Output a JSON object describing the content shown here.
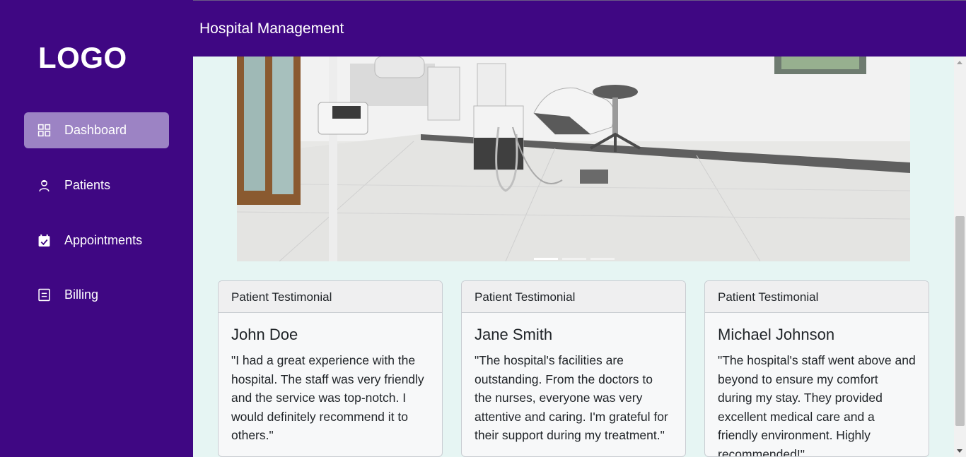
{
  "brand": {
    "logo_text": "LOGO"
  },
  "header": {
    "title": "Hospital Management"
  },
  "sidebar": {
    "items": [
      {
        "label": "Dashboard",
        "icon": "dashboard-grid-icon",
        "active": true
      },
      {
        "label": "Patients",
        "icon": "patient-icon",
        "active": false
      },
      {
        "label": "Appointments",
        "icon": "calendar-icon",
        "active": false
      },
      {
        "label": "Billing",
        "icon": "billing-document-icon",
        "active": false
      }
    ]
  },
  "carousel": {
    "slide_count": 3,
    "active_slide": 1
  },
  "testimonials": [
    {
      "header": "Patient Testimonial",
      "name": "John Doe",
      "text": "\"I had a great experience with the hospital. The staff was very friendly and the service was top-notch. I would definitely recommend it to others.\""
    },
    {
      "header": "Patient Testimonial",
      "name": "Jane Smith",
      "text": "\"The hospital's facilities are outstanding. From the doctors to the nurses, everyone was very attentive and caring. I'm grateful for their support during my treatment.\""
    },
    {
      "header": "Patient Testimonial",
      "name": "Michael Johnson",
      "text": "\"The hospital's staff went above and beyond to ensure my comfort during my stay. They provided excellent medical care and a friendly environment. Highly recommended!\""
    }
  ],
  "colors": {
    "sidebar_bg": "#3f0783",
    "active_item_bg": "#9c83c4",
    "page_bg": "#e6f5f3",
    "card_bg": "#f7f8f9"
  }
}
